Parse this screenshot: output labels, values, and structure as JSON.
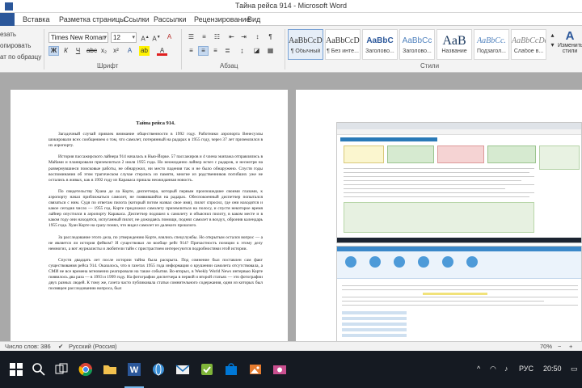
{
  "window": {
    "title": "Тайна рейса 914 - Microsoft Word"
  },
  "ribbon": {
    "tabs": [
      "Вставка",
      "Разметка страницы",
      "Ссылки",
      "Рассылки",
      "Рецензирование",
      "Вид"
    ],
    "clipboard": {
      "items": [
        "езать",
        "опировать",
        "ат по образцу"
      ]
    },
    "font": {
      "name": "Times New Roman",
      "size": "12",
      "group_label": "Шрифт"
    },
    "paragraph": {
      "group_label": "Абзац"
    },
    "styles": {
      "group_label": "Стили",
      "items": [
        {
          "preview": "AaBbCcDc",
          "name": "¶ Обычный",
          "selected": true
        },
        {
          "preview": "AaBbCcDc",
          "name": "¶ Без инте...",
          "selected": false
        },
        {
          "preview": "AaBbC",
          "name": "Заголово...",
          "selected": false
        },
        {
          "preview": "AaBbCc",
          "name": "Заголово...",
          "selected": false
        },
        {
          "preview": "AaB",
          "name": "Название",
          "selected": false
        },
        {
          "preview": "AaBbCc.",
          "name": "Подзагол...",
          "selected": false
        },
        {
          "preview": "AaBbCcDc",
          "name": "Слабое в...",
          "selected": false
        }
      ],
      "change_label_1": "Изменить",
      "change_label_2": "стили"
    }
  },
  "document": {
    "title": "Тайна рейса 914.",
    "paragraphs": [
      "Загадочный случай привлек внимание общественности в 1992 году. Работники аэропорта Венесуэлы шокировали всех сообщением о том, что самолет, потерянный на радарах в 1955 году, через 37 лет приземлился в их аэропорту.",
      "История пассажирского лайнера 914 началась в Нью-Йорке. 57 пассажиров и 4 члена экипажа отправлялись в Майами и планировали приземлиться 2 июля 1955 года. Но неожиданно лайнер исчез с радаров, и несмотря на развернувшиеся поисковые работы, не обнаружил, ни место падения так и не было обнаружено. Спустя годы воспоминания об этом трагическом случае стерлись из памяти, многие из родственников погибших уже не остались в живых, как в 1992 году из Каракаса пришла неожиданная новость.",
      "По свидетельству Хуана де ла Корте, диспетчера, который первым произошедшее своими глазами, к аэропорту начал приближаться самолет, не появившийся на радарах. Обеспокоенный диспетчер попытался связаться с ним. Судя по ответам пилота (который потом назвал свое имя), пилот спросил, где они находятся и какое сегодня число — 1955 год. Корте предложил самолету приземлиться на полосу, и спустя некоторое время лайнер опустился в аэропорту Каракаса. Диспетчер подошел к самолету и объяснил пилоту, в каком месте и в каком году они находятся, испуганный пилот, не дожидаясь помощи, поднял самолет в воздух, обронив календарь 1955 года. Хуан Корте на сразу понял, что видел самолет из далекого прошлого.",
      "За расследование этого дела, по утверждению Корте, взялись спецслужбы. Но открытым остался вопрос — а не является ли история фейком? И существовал ли вообще рейс 914? Причастность позиции к этому делу немногих, а вот журналисты и любители тайн с пристрастием интересуются подробностями этой истории.",
      "Спустя двадцать лет после истории тайна была раскрыта. Под сомнение был поставлен сам факт существования рейса 914. Оказалось, что в газетах 1955 года информация о крушении самолета отсутствовала, а СМИ не все времена мгновенно реагировали на такие события. Во-вторых, в Weekly World News интервью Корте появилось два раза — в 1993 и 1999 году. На фотографии диспетчера в первой и второй статьях — это фотографии двух разных людей. К тому же, газета часто публиковала статьи сомнительного содержания, одни из которых был посвящен расследованию вопроса, был"
    ]
  },
  "statusbar": {
    "words": "Число слов: 386",
    "language": "Русский (Россия)",
    "zoom": "70%"
  },
  "taskbar": {
    "lang": "РУС",
    "time": "20:50"
  }
}
